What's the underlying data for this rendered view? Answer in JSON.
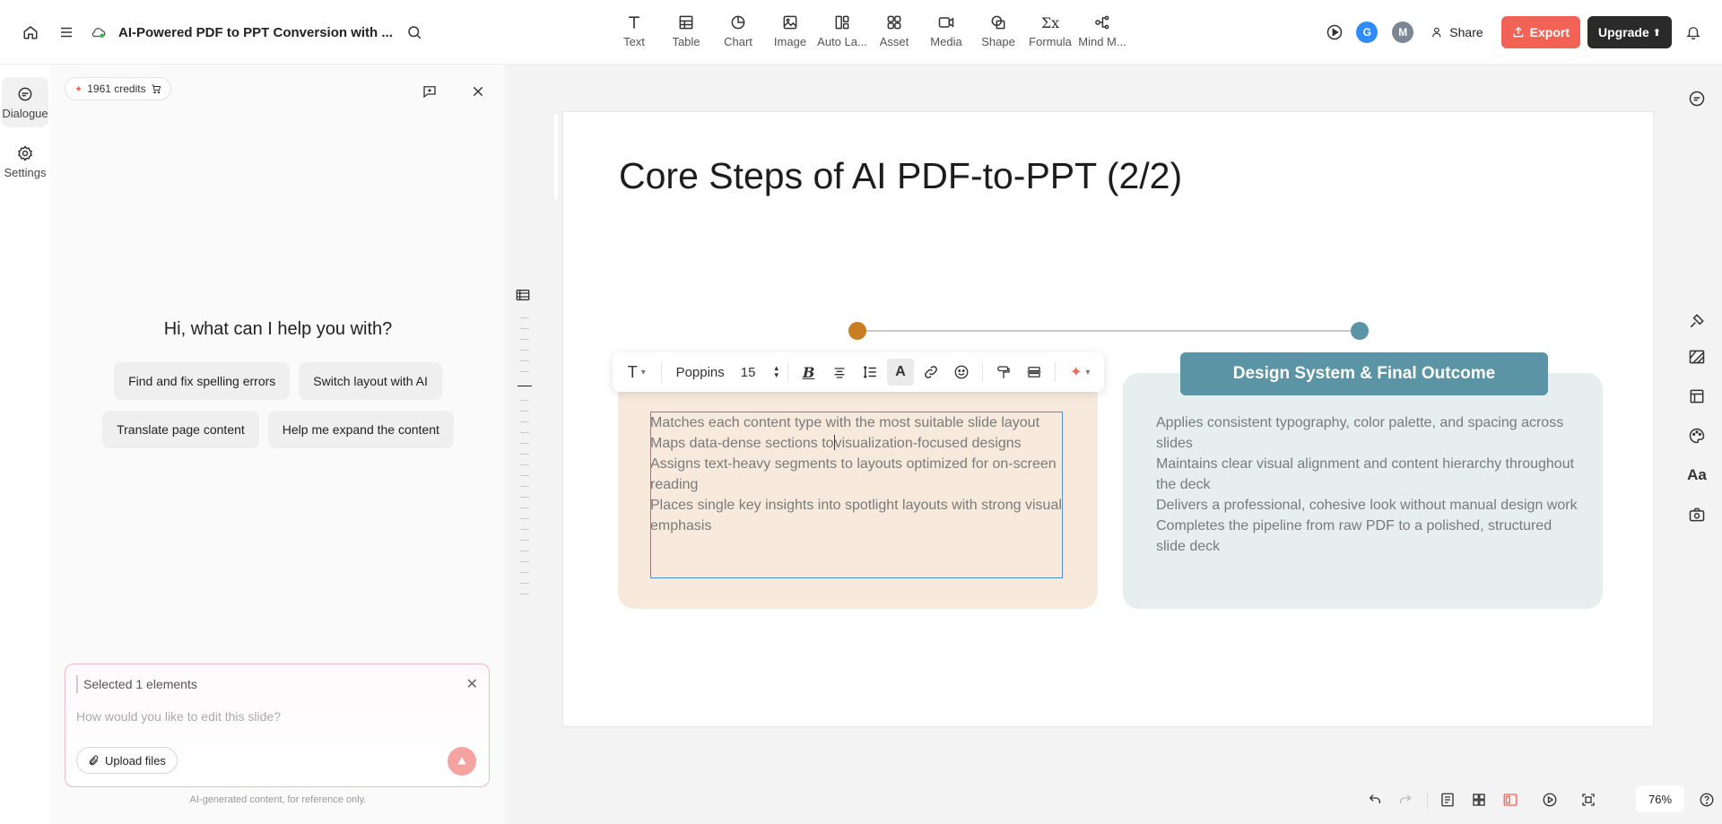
{
  "header": {
    "doc_title": "AI-Powered PDF to PPT Conversion with ...",
    "tools": [
      {
        "label": "Text",
        "icon": "text-icon"
      },
      {
        "label": "Table",
        "icon": "table-icon"
      },
      {
        "label": "Chart",
        "icon": "chart-icon"
      },
      {
        "label": "Image",
        "icon": "image-icon"
      },
      {
        "label": "Auto La...",
        "icon": "auto-layout-icon"
      },
      {
        "label": "Asset",
        "icon": "asset-icon"
      },
      {
        "label": "Media",
        "icon": "media-icon"
      },
      {
        "label": "Shape",
        "icon": "shape-icon"
      },
      {
        "label": "Formula",
        "icon": "formula-icon"
      },
      {
        "label": "Mind M...",
        "icon": "mind-map-icon"
      }
    ],
    "avatars": [
      {
        "letter": "G",
        "color": "#2f8cff"
      },
      {
        "letter": "M",
        "color": "#7c8794"
      }
    ],
    "share_label": "Share",
    "export_label": "Export",
    "upgrade_label": "Upgrade",
    "export_color": "#f26355"
  },
  "rail": {
    "dialogue_label": "Dialogue",
    "settings_label": "Settings"
  },
  "panel": {
    "credits": "1961 credits",
    "greeting": "Hi, what can I help you with?",
    "suggestions": [
      "Find and fix spelling errors",
      "Switch layout with AI",
      "Translate page content",
      "Help me expand the content"
    ],
    "selected_label": "Selected 1 elements",
    "prompt_placeholder": "How would you like to edit this slide?",
    "upload_label": "Upload files",
    "disclaimer": "AI-generated content, for reference only."
  },
  "slide": {
    "title": "Core Steps of AI PDF-to-PPT (2/2)",
    "left_color": "#c97d22",
    "right_color": "#5b94a4",
    "right_heading": "Design System & Final Outcome",
    "left_bullets": [
      "Matches each content type with the most suitable slide layout",
      "Maps data-dense sections to",
      "visualization-focused designs",
      "Assigns text-heavy segments to layouts optimized for on-screen reading",
      "Places single key insights into spotlight layouts with strong visual emphasis"
    ],
    "right_bullets": [
      "Applies consistent typography, color palette, and spacing across slides",
      "Maintains clear visual alignment and content hierarchy throughout the deck",
      "Delivers a professional, cohesive look without manual design work",
      "Completes the pipeline from raw PDF to a polished, structured slide deck"
    ]
  },
  "format_toolbar": {
    "font": "Poppins",
    "size": "15"
  },
  "bottom": {
    "zoom": "76%"
  }
}
